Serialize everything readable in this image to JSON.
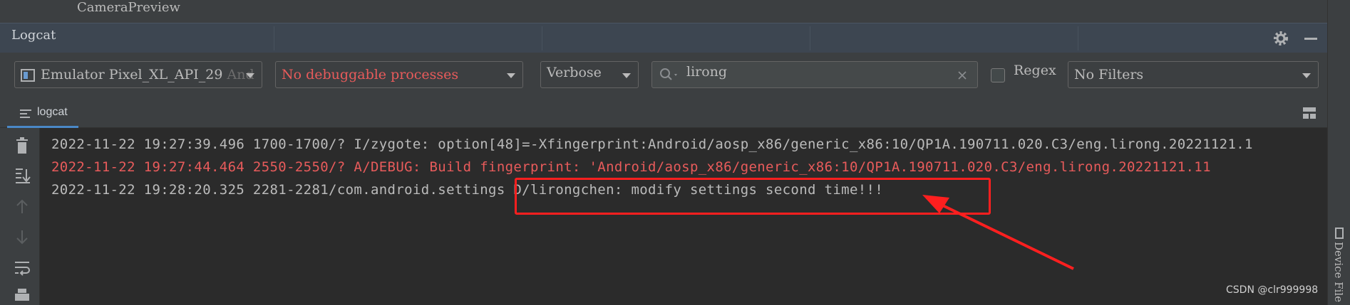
{
  "top": {
    "title": "CameraPreview"
  },
  "panel": {
    "title": "Logcat"
  },
  "toolbar": {
    "device": "Emulator Pixel_XL_API_29",
    "device_suffix": "And",
    "process": "No debuggable processes",
    "level": "Verbose",
    "search_value": "lirong",
    "regex_label": "Regex",
    "filter": "No Filters"
  },
  "tabs": {
    "logcat": "logcat"
  },
  "log_lines": [
    {
      "text": "2022-11-22 19:27:39.496 1700-1700/? I/zygote: option[48]=-Xfingerprint:Android/aosp_x86/generic_x86:10/QP1A.190711.020.C3/eng.lirong.20221121.1",
      "level": "info"
    },
    {
      "text": "2022-11-22 19:27:44.464 2550-2550/? A/DEBUG: Build fingerprint: 'Android/aosp_x86/generic_x86:10/QP1A.190711.020.C3/eng.lirong.20221121.11",
      "level": "error"
    },
    {
      "text": "2022-11-22 19:28:20.325 2281-2281/com.android.settings D/lirongchen: modify settings second time!!!",
      "level": "debug"
    }
  ],
  "right_tool": {
    "label": "Device File"
  },
  "watermark": "CSDN @clr999998",
  "colors": {
    "error_text": "#e85b5b",
    "annotation": "#ff1f1f",
    "accent": "#4a88c7"
  },
  "icons": [
    "gear-icon",
    "minimize-icon",
    "trash-icon",
    "scroll-to-end-icon",
    "up-arrow-icon",
    "down-arrow-icon",
    "soft-wrap-icon",
    "print-icon",
    "layout-icon",
    "search-icon",
    "clear-icon",
    "device-icon",
    "logcat-tab-icon"
  ]
}
